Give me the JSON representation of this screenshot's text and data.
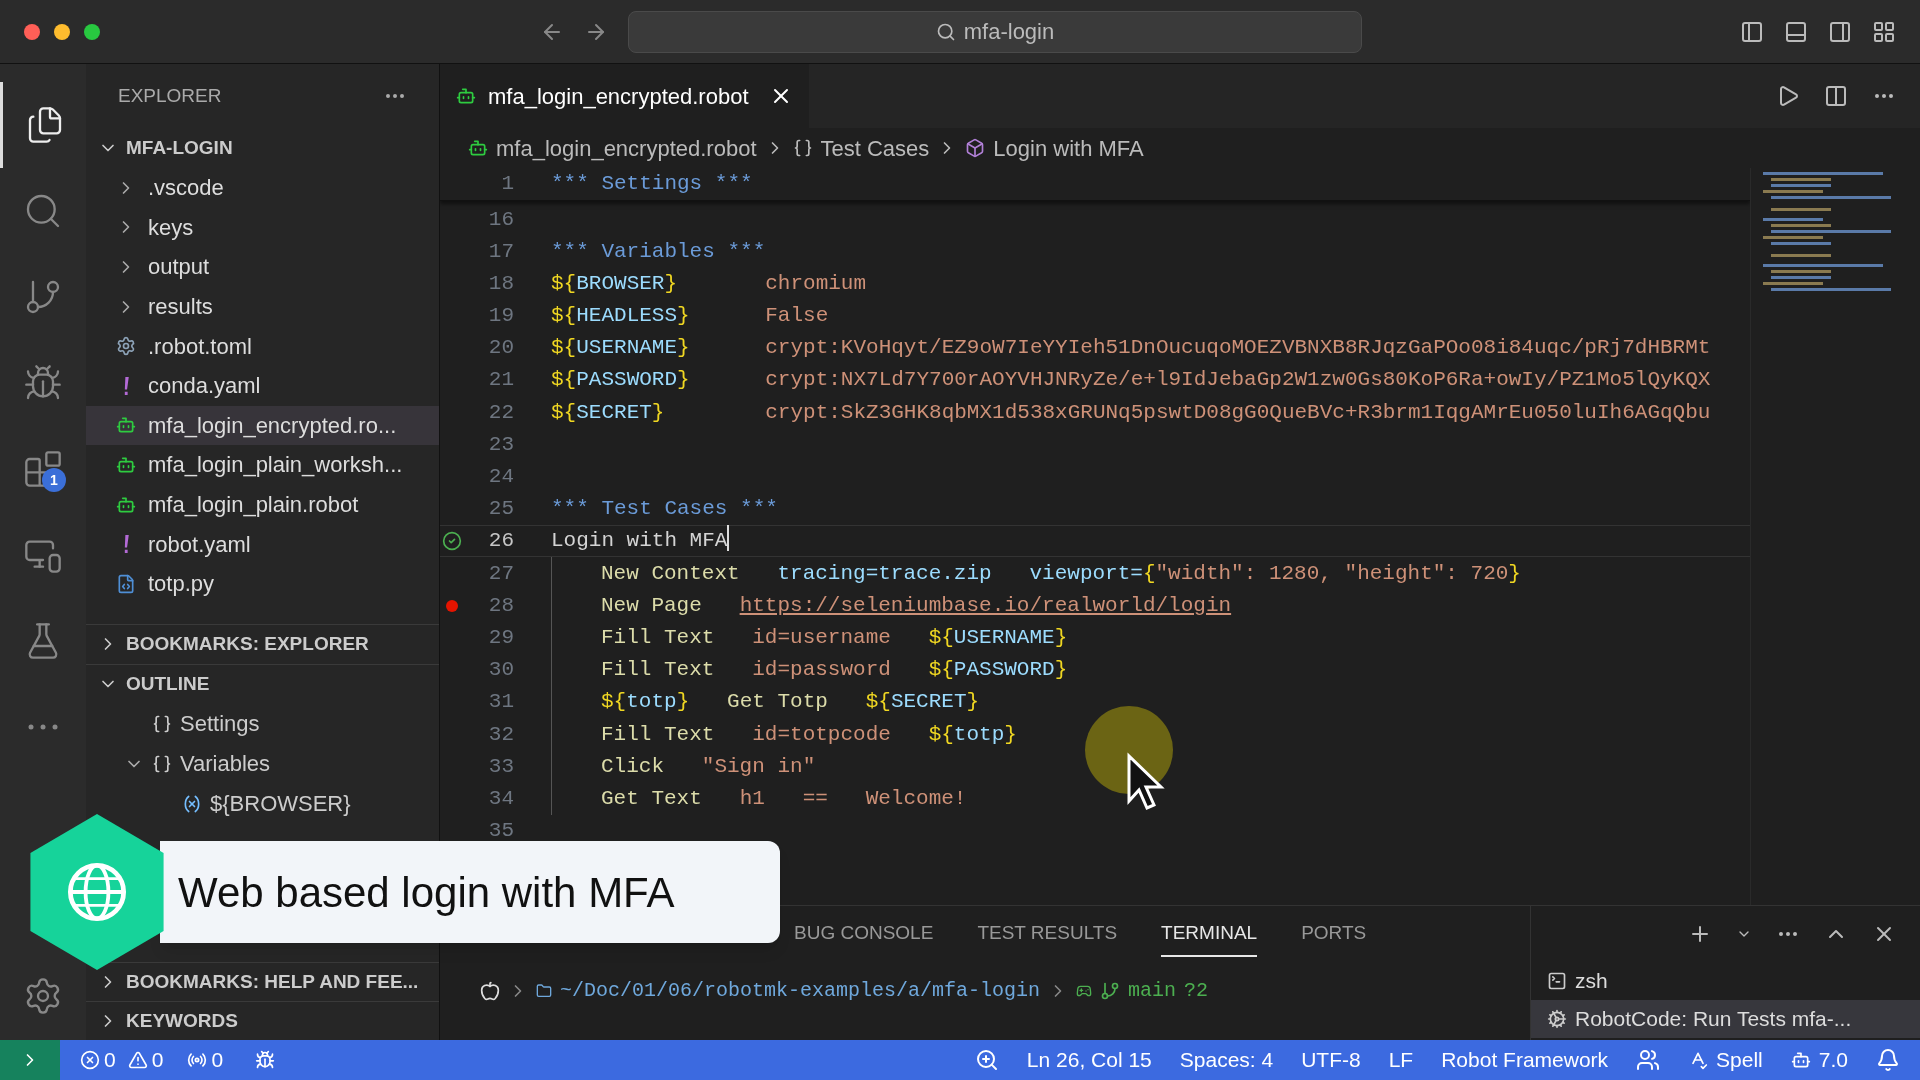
{
  "window": {
    "search": "mfa-login"
  },
  "activity_bar": {
    "items": [
      {
        "kind": "files",
        "selected": true
      },
      {
        "kind": "search",
        "selected": false
      },
      {
        "kind": "git",
        "selected": false
      },
      {
        "kind": "debug",
        "selected": false
      },
      {
        "kind": "extensions",
        "selected": false,
        "badge": "1"
      },
      {
        "kind": "remote",
        "selected": false
      },
      {
        "kind": "testing",
        "selected": false
      },
      {
        "kind": "more",
        "selected": false
      }
    ]
  },
  "sidebar": {
    "title": "EXPLORER",
    "folder": {
      "label": "MFA-LOGIN",
      "expanded": true
    },
    "items": [
      {
        "label": ".vscode",
        "kind": "folder",
        "selected": false
      },
      {
        "label": "keys",
        "kind": "folder",
        "selected": false
      },
      {
        "label": "output",
        "kind": "folder",
        "selected": false
      },
      {
        "label": "results",
        "kind": "folder",
        "selected": false
      },
      {
        "label": ".robot.toml",
        "kind": "gear",
        "selected": false
      },
      {
        "label": "conda.yaml",
        "kind": "yaml",
        "selected": false
      },
      {
        "label": "mfa_login_encrypted.ro...",
        "kind": "robot",
        "selected": true
      },
      {
        "label": "mfa_login_plain_worksh...",
        "kind": "robot",
        "selected": false
      },
      {
        "label": "mfa_login_plain.robot",
        "kind": "robot",
        "selected": false
      },
      {
        "label": "robot.yaml",
        "kind": "yaml",
        "selected": false
      },
      {
        "label": "totp.py",
        "kind": "python",
        "selected": false
      }
    ],
    "sections": [
      {
        "label": "BOOKMARKS: EXPLORER",
        "expanded": false
      }
    ],
    "outline": {
      "label": "OUTLINE",
      "expanded": true,
      "children": [
        {
          "label": "Settings",
          "kind": "section"
        },
        {
          "label": "Variables",
          "kind": "section",
          "expanded": true,
          "children": [
            {
              "label": "${BROWSER}",
              "kind": "variable"
            }
          ]
        }
      ]
    },
    "bottom_sections": [
      {
        "label": "BOOKMARKS: HELP AND FEE...",
        "expanded": false
      },
      {
        "label": "KEYWORDS",
        "expanded": false
      }
    ]
  },
  "editor": {
    "tab": {
      "label": "mfa_login_encrypted.robot",
      "selected": true
    },
    "breadcrumb": [
      "mfa_login_encrypted.robot",
      "Test Cases",
      "Login with MFA"
    ],
    "lines": [
      {
        "number": "1",
        "kind": "header",
        "cells": [
          [
            {
              "kind": "header",
              "text": "*** Settings ***"
            }
          ]
        ]
      },
      {
        "number": "16",
        "kind": "blank"
      },
      {
        "number": "17",
        "kind": "header",
        "cells": [
          [
            {
              "kind": "header",
              "text": "*** Variables ***"
            }
          ]
        ]
      },
      {
        "number": "18",
        "kind": "assign",
        "cells": [
          [
            {
              "kind": "brace",
              "text": "${"
            },
            {
              "kind": "var",
              "text": "BROWSER"
            },
            {
              "kind": "brace",
              "text": "}"
            }
          ],
          [
            {
              "kind": "value",
              "text": "chromium"
            }
          ]
        ]
      },
      {
        "number": "19",
        "kind": "assign",
        "cells": [
          [
            {
              "kind": "brace",
              "text": "${"
            },
            {
              "kind": "var",
              "text": "HEADLESS"
            },
            {
              "kind": "brace",
              "text": "}"
            }
          ],
          [
            {
              "kind": "value",
              "text": "False"
            }
          ]
        ]
      },
      {
        "number": "20",
        "kind": "assign",
        "cells": [
          [
            {
              "kind": "brace",
              "text": "${"
            },
            {
              "kind": "var",
              "text": "USERNAME"
            },
            {
              "kind": "brace",
              "text": "}"
            }
          ],
          [
            {
              "kind": "value",
              "text": "crypt:KVoHqyt/EZ9oW7IeYYIeh51DnOucuqoMOEZVBNXB8RJqzGaPOo08i84uqc/pRj7dHBRMt"
            }
          ]
        ]
      },
      {
        "number": "21",
        "kind": "assign",
        "cells": [
          [
            {
              "kind": "brace",
              "text": "${"
            },
            {
              "kind": "var",
              "text": "PASSWORD"
            },
            {
              "kind": "brace",
              "text": "}"
            }
          ],
          [
            {
              "kind": "value",
              "text": "crypt:NX7Ld7Y700rAOYVHJNRyZe/e+l9IdJebaGp2W1zw0Gs80KoP6Ra+owIy/PZ1Mo5lQyKQX"
            }
          ]
        ]
      },
      {
        "number": "22",
        "kind": "assign",
        "cells": [
          [
            {
              "kind": "brace",
              "text": "${"
            },
            {
              "kind": "var",
              "text": "SECRET"
            },
            {
              "kind": "brace",
              "text": "}"
            }
          ],
          [
            {
              "kind": "value",
              "text": "crypt:SkZ3GHK8qbMX1d538xGRUNq5pswtD08gG0QueBVc+R3brm1IqgAMrEu050luIh6AGqQbu"
            }
          ]
        ]
      },
      {
        "number": "23",
        "kind": "blank"
      },
      {
        "number": "24",
        "kind": "blank"
      },
      {
        "number": "25",
        "kind": "header",
        "cells": [
          [
            {
              "kind": "header",
              "text": "*** Test Cases ***"
            }
          ]
        ]
      },
      {
        "number": "26",
        "kind": "testname",
        "current": true,
        "passed": true,
        "cells": [
          [
            {
              "kind": "plain",
              "text": "Login with MFA"
            }
          ]
        ]
      },
      {
        "number": "27",
        "kind": "step",
        "cells": [
          [
            {
              "kind": "keyword",
              "text": "New Context"
            }
          ],
          [
            {
              "kind": "param",
              "text": "tracing=trace.zip"
            }
          ],
          [
            {
              "kind": "param",
              "text": "viewport="
            },
            {
              "kind": "brace",
              "text": "{"
            },
            {
              "kind": "value",
              "text": "\"width\": 1280, \"height\": 720"
            },
            {
              "kind": "brace",
              "text": "}"
            }
          ]
        ]
      },
      {
        "number": "28",
        "kind": "step",
        "breakpoint": true,
        "cells": [
          [
            {
              "kind": "keyword",
              "text": "New Page"
            }
          ],
          [
            {
              "kind": "url",
              "text": "https://seleniumbase.io/realworld/login"
            }
          ]
        ]
      },
      {
        "number": "29",
        "kind": "step",
        "cells": [
          [
            {
              "kind": "keyword",
              "text": "Fill Text"
            }
          ],
          [
            {
              "kind": "value",
              "text": "id=username"
            }
          ],
          [
            {
              "kind": "brace",
              "text": "${"
            },
            {
              "kind": "var",
              "text": "USERNAME"
            },
            {
              "kind": "brace",
              "text": "}"
            }
          ]
        ]
      },
      {
        "number": "30",
        "kind": "step",
        "cells": [
          [
            {
              "kind": "keyword",
              "text": "Fill Text"
            }
          ],
          [
            {
              "kind": "value",
              "text": "id=password"
            }
          ],
          [
            {
              "kind": "brace",
              "text": "${"
            },
            {
              "kind": "var",
              "text": "PASSWORD"
            },
            {
              "kind": "brace",
              "text": "}"
            }
          ]
        ]
      },
      {
        "number": "31",
        "kind": "step",
        "cells": [
          [
            {
              "kind": "brace",
              "text": "${"
            },
            {
              "kind": "var",
              "text": "totp"
            },
            {
              "kind": "brace",
              "text": "}"
            }
          ],
          [
            {
              "kind": "keyword",
              "text": "Get Totp"
            }
          ],
          [
            {
              "kind": "brace",
              "text": "${"
            },
            {
              "kind": "var",
              "text": "SECRET"
            },
            {
              "kind": "brace",
              "text": "}"
            }
          ]
        ]
      },
      {
        "number": "32",
        "kind": "step",
        "cells": [
          [
            {
              "kind": "keyword",
              "text": "Fill Text"
            }
          ],
          [
            {
              "kind": "value",
              "text": "id=totpcode"
            }
          ],
          [
            {
              "kind": "brace",
              "text": "${"
            },
            {
              "kind": "var",
              "text": "totp"
            },
            {
              "kind": "brace",
              "text": "}"
            }
          ]
        ]
      },
      {
        "number": "33",
        "kind": "step",
        "cells": [
          [
            {
              "kind": "keyword",
              "text": "Click"
            }
          ],
          [
            {
              "kind": "value",
              "text": "\"Sign in\""
            }
          ]
        ]
      },
      {
        "number": "34",
        "kind": "step",
        "cells": [
          [
            {
              "kind": "keyword",
              "text": "Get Text"
            }
          ],
          [
            {
              "kind": "value",
              "text": "h1"
            }
          ],
          [
            {
              "kind": "value",
              "text": "=="
            }
          ],
          [
            {
              "kind": "value",
              "text": "Welcome!"
            }
          ]
        ]
      },
      {
        "number": "35",
        "kind": "blank"
      }
    ]
  },
  "panel": {
    "tabs": [
      {
        "label": "BUG CONSOLE",
        "selected": false
      },
      {
        "label": "TEST RESULTS",
        "selected": false
      },
      {
        "label": "TERMINAL",
        "selected": true
      },
      {
        "label": "PORTS",
        "selected": false
      }
    ],
    "prompt": {
      "path": "~/Doc/01/06/robotmk-examples/a/mfa-login",
      "branch": "main",
      "status": "?2"
    },
    "terminals": [
      {
        "label": "zsh",
        "kind": "shell",
        "selected": false
      },
      {
        "label": "RobotCode: Run Tests mfa-...",
        "kind": "task",
        "selected": true
      }
    ]
  },
  "status_bar": {
    "errors": "0",
    "warnings": "0",
    "ports": "0",
    "right": [
      {
        "kind": "zoom"
      },
      {
        "kind": "text",
        "text": "Ln 26, Col 15"
      },
      {
        "kind": "text",
        "text": "Spaces: 4"
      },
      {
        "kind": "text",
        "text": "UTF-8"
      },
      {
        "kind": "text",
        "text": "LF"
      },
      {
        "kind": "text",
        "text": "Robot Framework"
      },
      {
        "kind": "copilot"
      },
      {
        "kind": "spell",
        "text": "Spell"
      },
      {
        "kind": "version",
        "text": "7.0"
      },
      {
        "kind": "bell"
      }
    ]
  },
  "caption": {
    "text": "Web based login with MFA"
  }
}
